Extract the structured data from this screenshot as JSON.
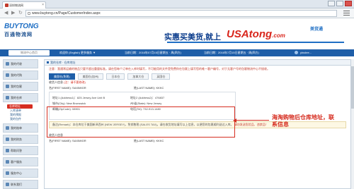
{
  "browser": {
    "tab_title": "深圳物流网",
    "url": "www.buytong.cn/Page/CustomerIndex.aspx"
  },
  "header": {
    "logo_en": "BUYTONG",
    "logo_cn": "百通物流网",
    "slogan": "实惠买美货,就上",
    "brand": "USAtong",
    "brand_suffix": ".com",
    "brand_cn": "美货通"
  },
  "topnav": {
    "search_placeholder": "物流中心首页",
    "welcome": "欢迎你 (English) 更多服务 ▼",
    "time1": "当前日期：2016年07月15日星期五 · 周(四方)",
    "time2": "当前日期：2016年7月15日星期五 · 周(四方)",
    "user": "yinolee..."
  },
  "sidebar": {
    "items": [
      {
        "label": "我的代收"
      },
      {
        "label": "我的代购"
      },
      {
        "label": "我的包裹"
      },
      {
        "label": "我的仓库"
      }
    ],
    "subitems": [
      {
        "label": "仓库地址",
        "active": true
      },
      {
        "label": "入库清单",
        "active": false
      },
      {
        "label": "我的预报",
        "active": false
      },
      {
        "label": "我的包件",
        "active": false
      }
    ],
    "items_bottom": [
      {
        "label": "我的账单"
      },
      {
        "label": "我的财务"
      },
      {
        "label": "帮助问答"
      },
      {
        "label": "客户服务"
      },
      {
        "label": "服务中心"
      },
      {
        "label": "联系我们"
      }
    ]
  },
  "main": {
    "title": "我的仓库 · 仓库地址",
    "notice": "注意：我通常运输的物品只要不超出重量标准。请在您每个订单在入库时填写，不可能用的文件是免费你在包裹上填写您的唯一客户编号，对于无客户号的包裹物流中心不接收。",
    "tabs": [
      "美国仓(免税)",
      "美国仓(加州)",
      "日本仓",
      "加拿大仓",
      "英国仓"
    ],
    "section_title": "收货人信息",
    "section_sub": "(注：请不要修改)",
    "name_row": {
      "first": "名(FIRST NAME): SAXIMIGR",
      "last": "姓(LAST NAME): KKKC"
    },
    "address": {
      "addr1": "地址1 (Address1)：825 Jersey Ave Unit B",
      "addr2": "地址2 (Address2)：476837",
      "city": "城市(City): New Brunswick",
      "state": "州/省(State): New Jersey",
      "zip": "邮编(ZipCode): 08901",
      "tel": "电话(Tel): 732-913-1480"
    },
    "remark": "备注(Remark)：本仓库位于美国新泽西州 (NEW JERSEY)，免销售税 (SALES TAX)。请在收货地址填写以上信息，以便您的包裹顺利送达入库。",
    "remark_warn": "请勿发送危险品、违禁品！",
    "section2_title": "收货人信息",
    "name_row2": {
      "first": "名(FIRST NAME): SAXIMIGR",
      "last": "姓(LAST NAME): KKKC"
    }
  },
  "callout": {
    "text": "海淘购物后仓库地址，联系信息"
  },
  "colors": {
    "brand_blue": "#1e5ea8",
    "accent_red": "#d62d20"
  }
}
